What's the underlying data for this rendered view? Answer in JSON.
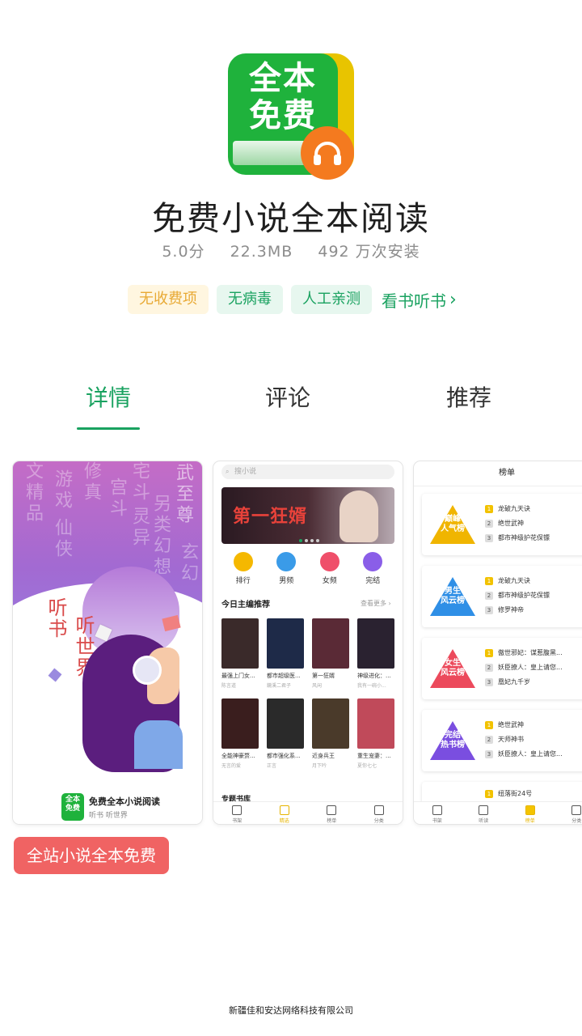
{
  "app": {
    "icon_text": "全本免费",
    "name": "免费小说全本阅读",
    "rating": "5.0分",
    "size": "22.3MB",
    "installs": "492 万次安装"
  },
  "tags": {
    "fee": "无收费项",
    "virus": "无病毒",
    "tested": "人工亲测",
    "link": "看书听书",
    "link_arrow": "›"
  },
  "tabs": [
    "详情",
    "评论",
    "推荐"
  ],
  "screenshots": {
    "shot1": {
      "bg_chars": [
        "文精品",
        "游戏",
        "仙侠",
        "修真",
        "宫斗",
        "宅斗",
        "灵异",
        "另类幻想",
        "武至尊",
        "玄幻"
      ],
      "title_a": "听书",
      "title_b": "听世界",
      "mini_icon": "全本免费",
      "mini_name": "免费全本小说阅读",
      "mini_sub": "听书 听世界"
    },
    "shot2": {
      "search_placeholder": "搜小说",
      "banner_title": "第一狂婿",
      "categories": [
        {
          "label": "排行",
          "color": "#f5b800"
        },
        {
          "label": "男频",
          "color": "#3a9be8"
        },
        {
          "label": "女频",
          "color": "#ef4f6a"
        },
        {
          "label": "完结",
          "color": "#8a5ee8"
        }
      ],
      "section_title": "今日主编推荐",
      "section_more": "查看更多 ›",
      "books": [
        {
          "title": "最强上门女...",
          "author": "陈言道",
          "color": "#3a2a2a"
        },
        {
          "title": "都市超级医...",
          "author": "鏡溪二君子",
          "color": "#1e2a48"
        },
        {
          "title": "第一狂婿",
          "author": "风闲",
          "color": "#5a2a36"
        },
        {
          "title": "神级进化：...",
          "author": "我有一碗小...",
          "color": "#2a2230"
        },
        {
          "title": "全能神豪赘...",
          "author": "无言的爱",
          "color": "#3a1e1e"
        },
        {
          "title": "都市强化系...",
          "author": "正言",
          "color": "#2a2a2a"
        },
        {
          "title": "近身兵王",
          "author": "月下吟",
          "color": "#4a3a2a"
        },
        {
          "title": "重生宠妻：...",
          "author": "夏你七七",
          "color": "#c04a5a"
        }
      ],
      "bottom_title": "专题书库",
      "nav": [
        "书架",
        "精选",
        "榜单",
        "分类"
      ]
    },
    "shot3": {
      "header": "榜单",
      "cards": [
        {
          "badge": "巅峰\n人气榜",
          "color": "#f0b500",
          "items": [
            "龙破九天诀",
            "绝世武神",
            "都市神级护花保镖"
          ]
        },
        {
          "badge": "男生\n风云榜",
          "color": "#2f8fe6",
          "items": [
            "龙破九天诀",
            "都市神级护花保镖",
            "修罗神帝"
          ]
        },
        {
          "badge": "女生\n风云榜",
          "color": "#ec4a5c",
          "items": [
            "傲世邪妃：谋惹腹黑...",
            "妖臣撩人：皇上请您...",
            "凰妃九千岁"
          ]
        },
        {
          "badge": "完结\n热书榜",
          "color": "#7a4ee0",
          "items": [
            "绝世武神",
            "天师神书",
            "妖臣撩人：皇上请您..."
          ]
        },
        {
          "badge": "",
          "color": "#f0b500",
          "items": [
            "纽落街24号"
          ]
        }
      ],
      "nav": [
        "书架",
        "听读",
        "榜单",
        "分类"
      ]
    }
  },
  "promo": "全站小说全本免费",
  "footer": "新疆佳和安达网络科技有限公司"
}
